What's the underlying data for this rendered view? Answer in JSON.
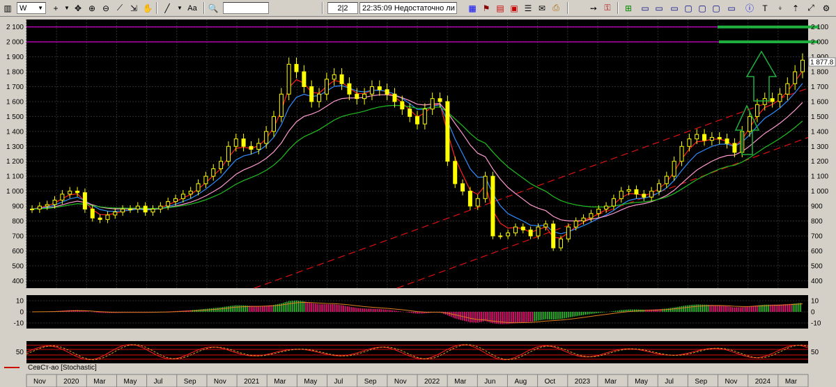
{
  "toolbar": {
    "symbol": "W",
    "page_indicator": "2|2",
    "time": "22:35:09",
    "status_text": "Недостаточно ли",
    "font_button": "Aa",
    "tools": [
      "cursor-plus-icon",
      "crosshair-icon",
      "zoom-in-icon",
      "zoom-out-icon",
      "ruler-icon",
      "hand-icon",
      "line-tool-icon",
      "text-size-icon",
      "search-icon",
      "open-icon",
      "flag-icon",
      "calc-icon",
      "table-icon",
      "mail-icon",
      "print-icon",
      "arrow-icon",
      "key-icon",
      "add-icon",
      "window-icon",
      "window2-icon",
      "window3-icon",
      "window4-icon",
      "window5-icon",
      "info-icon",
      "text-tool-icon",
      "pin-icon"
    ]
  },
  "colors": {
    "background": "#000000",
    "grid": "#2f2f2f",
    "candle_up": "#ffff00",
    "price_line": "#ff00ff",
    "ma_fast": "#ff2020",
    "ma_mid": "#2f8cff",
    "ma_slow": "#ff9ad0",
    "ma_long": "#20c020",
    "channel": "#e01010",
    "target": "#20b040"
  },
  "price_axis": {
    "labels": [
      "2 100",
      "2 000",
      "1 900",
      "1 800",
      "1 700",
      "1 600",
      "1 500",
      "1 400",
      "1 300",
      "1 200",
      "1 100",
      "1 000",
      "900",
      "800",
      "700",
      "600",
      "500",
      "400"
    ],
    "current_price": "1 877.8"
  },
  "indicator1": {
    "labels": [
      "10",
      "0",
      "-10"
    ]
  },
  "indicator2": {
    "labels": [
      "50"
    ],
    "legend": "СевСт-ао [Stochastic]"
  },
  "time_axis": {
    "labels": [
      "Nov",
      "2020",
      "Mar",
      "May",
      "Jul",
      "Sep",
      "Nov",
      "2021",
      "Mar",
      "May",
      "Jul",
      "Sep",
      "Nov",
      "2022",
      "Mar",
      "Jun",
      "Aug",
      "Oct",
      "2023",
      "Mar",
      "May",
      "Jul",
      "Sep",
      "Nov",
      "2024",
      "Mar"
    ]
  },
  "chart_data": {
    "type": "candlestick",
    "title": "",
    "y_axis_range": [
      350,
      2150
    ],
    "horizontal_levels": [
      2100,
      2000
    ],
    "weekly_closes": [
      880,
      900,
      910,
      940,
      980,
      1000,
      990,
      880,
      820,
      810,
      840,
      860,
      880,
      880,
      900,
      860,
      880,
      900,
      930,
      950,
      980,
      1000,
      1050,
      1100,
      1150,
      1200,
      1300,
      1350,
      1300,
      1280,
      1320,
      1400,
      1500,
      1650,
      1850,
      1800,
      1700,
      1600,
      1650,
      1750,
      1780,
      1720,
      1650,
      1620,
      1650,
      1700,
      1680,
      1650,
      1600,
      1550,
      1500,
      1450,
      1550,
      1620,
      1600,
      1200,
      1050,
      1000,
      900,
      950,
      1100,
      700,
      700,
      720,
      760,
      740,
      700,
      760,
      780,
      620,
      680,
      760,
      800,
      820,
      850,
      880,
      900,
      950,
      1000,
      1010,
      980,
      960,
      1000,
      1050,
      1100,
      1200,
      1300,
      1350,
      1380,
      1340,
      1360,
      1350,
      1320,
      1260,
      1400,
      1500,
      1580,
      1620,
      1600,
      1650,
      1720,
      1800,
      1877.8
    ]
  }
}
